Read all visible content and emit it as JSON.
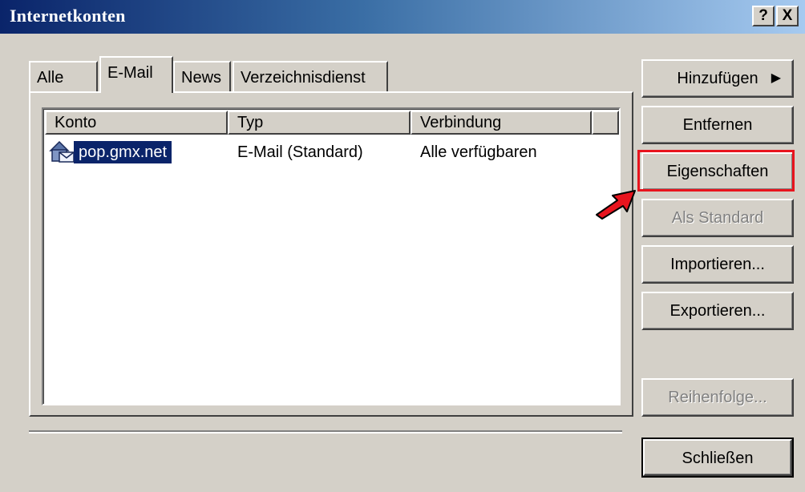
{
  "window": {
    "title": "Internetkonten",
    "help_label": "?",
    "close_label": "X"
  },
  "tabs": [
    {
      "label": "Alle"
    },
    {
      "label": "E-Mail"
    },
    {
      "label": "News"
    },
    {
      "label": "Verzeichnisdienst"
    }
  ],
  "list": {
    "columns": [
      "Konto",
      "Typ",
      "Verbindung"
    ],
    "rows": [
      {
        "account": "pop.gmx.net",
        "type": "E-Mail (Standard)",
        "connection": "Alle verfügbaren",
        "icon": "mail-account-icon"
      }
    ]
  },
  "buttons": {
    "add": "Hinzufügen",
    "remove": "Entfernen",
    "properties": "Eigenschaften",
    "set_default": "Als Standard",
    "import": "Importieren...",
    "export": "Exportieren...",
    "order": "Reihenfolge...",
    "close": "Schließen"
  },
  "colors": {
    "highlight": "#e8141e",
    "selection": "#0a246a",
    "face": "#d4d0c8"
  }
}
